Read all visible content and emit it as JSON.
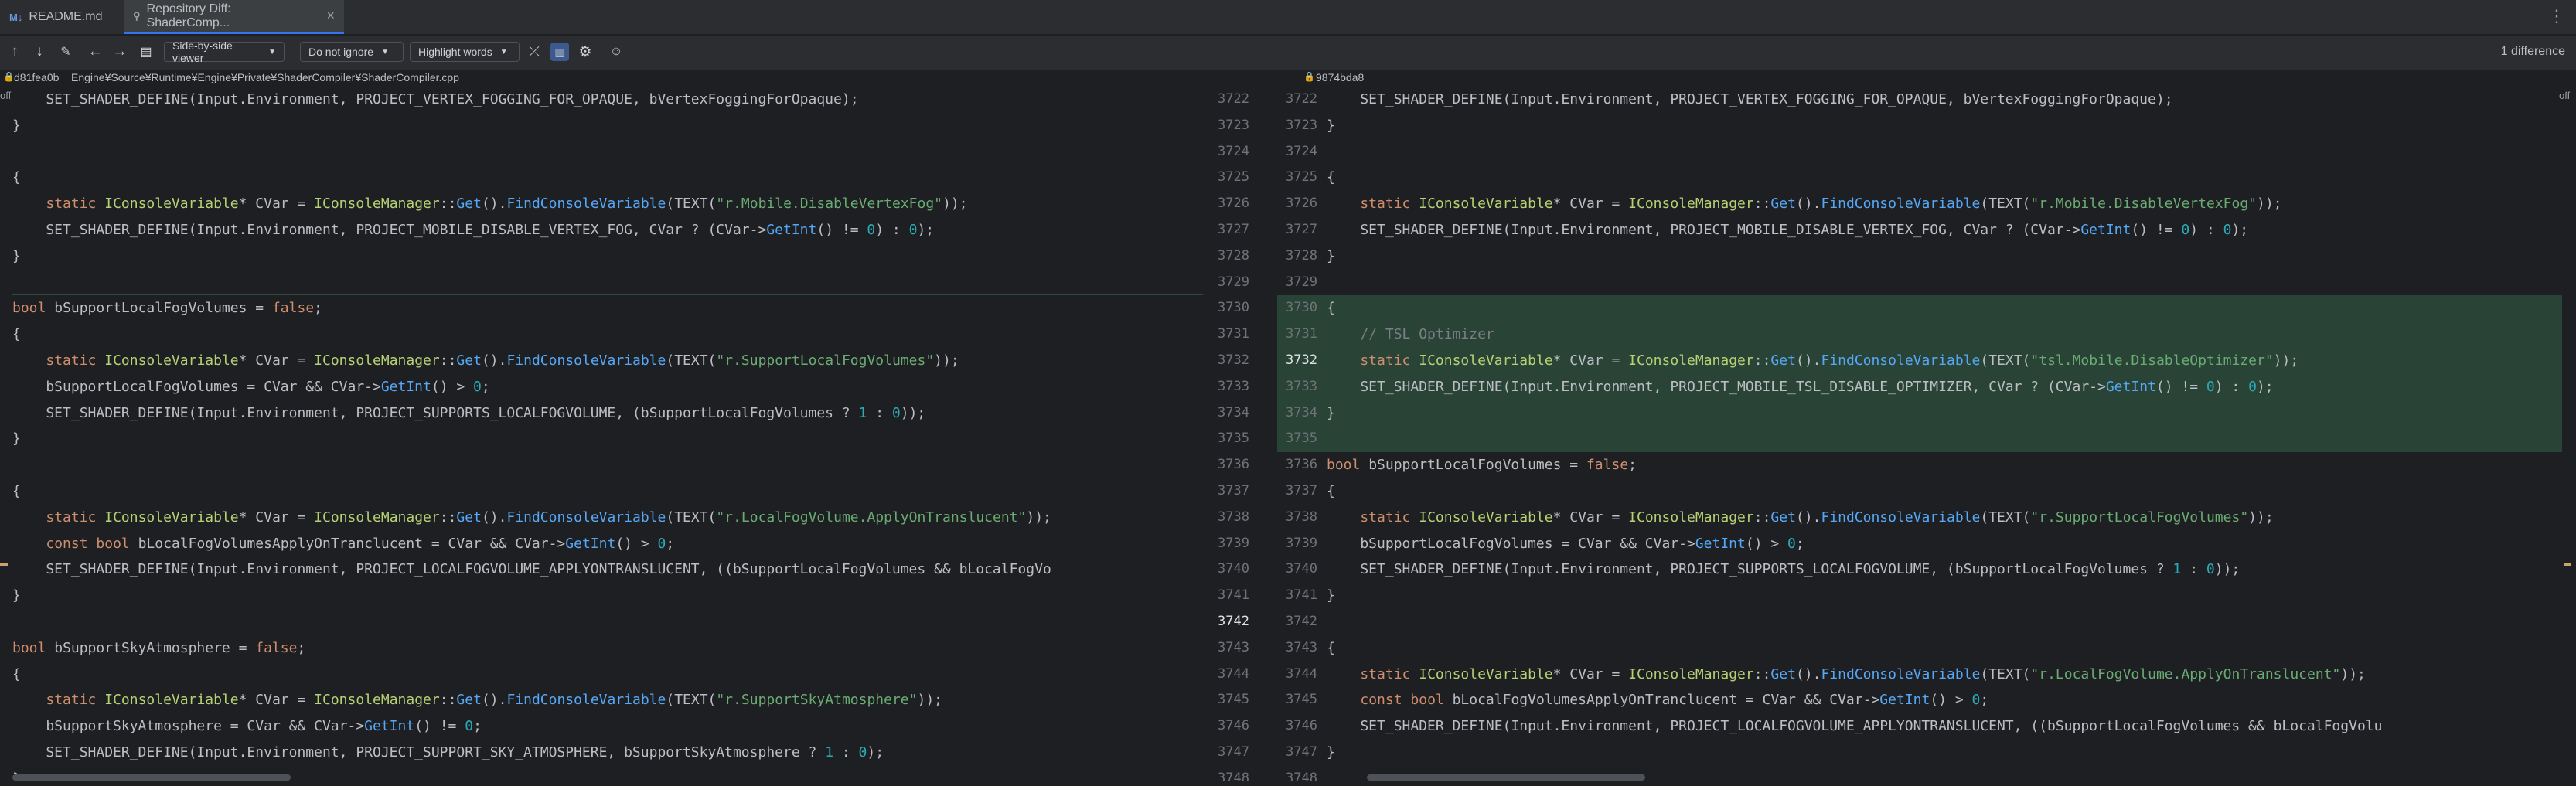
{
  "tabs": [
    {
      "icon": "M↓",
      "label": "README.md",
      "active": false
    },
    {
      "icon": "⚲",
      "label": "Repository Diff: ShaderComp...",
      "active": true
    }
  ],
  "toolbar": {
    "viewer_mode": "Side-by-side viewer",
    "ignore_mode": "Do not ignore",
    "highlight_mode": "Highlight words",
    "diff_count": "1 difference"
  },
  "left": {
    "revision": "d81fea0b",
    "path": "Engine¥Source¥Runtime¥Engine¥Private¥ShaderCompiler¥ShaderCompiler.cpp",
    "edge_label": "off",
    "numbers": [
      "3722",
      "3723",
      "3724",
      "3725",
      "3726",
      "3727",
      "3728",
      "3729",
      "3730",
      "3731",
      "3732",
      "3733",
      "3734",
      "3735",
      "3736",
      "3737",
      "3738",
      "3739",
      "3740",
      "3741",
      "3742",
      "3743",
      "3744",
      "3745",
      "3746",
      "3747",
      "3748"
    ]
  },
  "right": {
    "revision": "9874bda8",
    "edge_label": "off",
    "numbers": [
      "3722",
      "3723",
      "3724",
      "3725",
      "3726",
      "3727",
      "3728",
      "3729",
      "3730",
      "3731",
      "3732",
      "3733",
      "3734",
      "3735",
      "3736",
      "3737",
      "3738",
      "3739",
      "3740",
      "3741",
      "3742",
      "3743",
      "3744",
      "3745",
      "3746",
      "3747",
      "3748"
    ]
  },
  "left_code": [
    "    SET_SHADER_DEFINE(Input.Environment, PROJECT_VERTEX_FOGGING_FOR_OPAQUE, bVertexFoggingForOpaque);",
    "}",
    "",
    "{",
    "    static IConsoleVariable* CVar = IConsoleManager::Get().FindConsoleVariable(TEXT(\"r.Mobile.DisableVertexFog\"));",
    "    SET_SHADER_DEFINE(Input.Environment, PROJECT_MOBILE_DISABLE_VERTEX_FOG, CVar ? (CVar->GetInt() != 0) : 0);",
    "}",
    "",
    "bool bSupportLocalFogVolumes = false;",
    "{",
    "    static IConsoleVariable* CVar = IConsoleManager::Get().FindConsoleVariable(TEXT(\"r.SupportLocalFogVolumes\"));",
    "    bSupportLocalFogVolumes = CVar && CVar->GetInt() > 0;",
    "    SET_SHADER_DEFINE(Input.Environment, PROJECT_SUPPORTS_LOCALFOGVOLUME, (bSupportLocalFogVolumes ? 1 : 0));",
    "}",
    "",
    "{",
    "    static IConsoleVariable* CVar = IConsoleManager::Get().FindConsoleVariable(TEXT(\"r.LocalFogVolume.ApplyOnTranslucent\"));",
    "    const bool bLocalFogVolumesApplyOnTranclucent = CVar && CVar->GetInt() > 0;",
    "    SET_SHADER_DEFINE(Input.Environment, PROJECT_LOCALFOGVOLUME_APPLYONTRANSLUCENT, ((bSupportLocalFogVolumes && bLocalFogVo",
    "}",
    "",
    "bool bSupportSkyAtmosphere = false;",
    "{",
    "    static IConsoleVariable* CVar = IConsoleManager::Get().FindConsoleVariable(TEXT(\"r.SupportSkyAtmosphere\"));",
    "    bSupportSkyAtmosphere = CVar && CVar->GetInt() != 0;",
    "    SET_SHADER_DEFINE(Input.Environment, PROJECT_SUPPORT_SKY_ATMOSPHERE, bSupportSkyAtmosphere ? 1 : 0);",
    "}"
  ],
  "right_code": [
    "    SET_SHADER_DEFINE(Input.Environment, PROJECT_VERTEX_FOGGING_FOR_OPAQUE, bVertexFoggingForOpaque);",
    "}",
    "",
    "{",
    "    static IConsoleVariable* CVar = IConsoleManager::Get().FindConsoleVariable(TEXT(\"r.Mobile.DisableVertexFog\"));",
    "    SET_SHADER_DEFINE(Input.Environment, PROJECT_MOBILE_DISABLE_VERTEX_FOG, CVar ? (CVar->GetInt() != 0) : 0);",
    "}",
    "",
    "{",
    "    // TSL Optimizer",
    "    static IConsoleVariable* CVar = IConsoleManager::Get().FindConsoleVariable(TEXT(\"tsl.Mobile.DisableOptimizer\"));",
    "    SET_SHADER_DEFINE(Input.Environment, PROJECT_MOBILE_TSL_DISABLE_OPTIMIZER, CVar ? (CVar->GetInt() != 0) : 0);",
    "}",
    "",
    "bool bSupportLocalFogVolumes = false;",
    "{",
    "    static IConsoleVariable* CVar = IConsoleManager::Get().FindConsoleVariable(TEXT(\"r.SupportLocalFogVolumes\"));",
    "    bSupportLocalFogVolumes = CVar && CVar->GetInt() > 0;",
    "    SET_SHADER_DEFINE(Input.Environment, PROJECT_SUPPORTS_LOCALFOGVOLUME, (bSupportLocalFogVolumes ? 1 : 0));",
    "}",
    "",
    "{",
    "    static IConsoleVariable* CVar = IConsoleManager::Get().FindConsoleVariable(TEXT(\"r.LocalFogVolume.ApplyOnTranslucent\"));",
    "    const bool bLocalFogVolumesApplyOnTranclucent = CVar && CVar->GetInt() > 0;",
    "    SET_SHADER_DEFINE(Input.Environment, PROJECT_LOCALFOGVOLUME_APPLYONTRANSLUCENT, ((bSupportLocalFogVolumes && bLocalFogVolu",
    "}"
  ],
  "colors": {
    "background": "#1e1f22",
    "added_block": "#294436",
    "keyword": "#cf8e6d",
    "string": "#6aab73",
    "function": "#56a8f5",
    "number": "#2aacb8",
    "comment": "#7a7e85"
  },
  "icons": [
    "arrow-up-icon",
    "arrow-down-icon",
    "pencil-icon",
    "arrow-left-icon",
    "arrow-right-icon",
    "file-icon",
    "collapse-icon",
    "side-by-side-icon",
    "settings-icon",
    "help-icon",
    "more-icon",
    "lock-icon"
  ]
}
